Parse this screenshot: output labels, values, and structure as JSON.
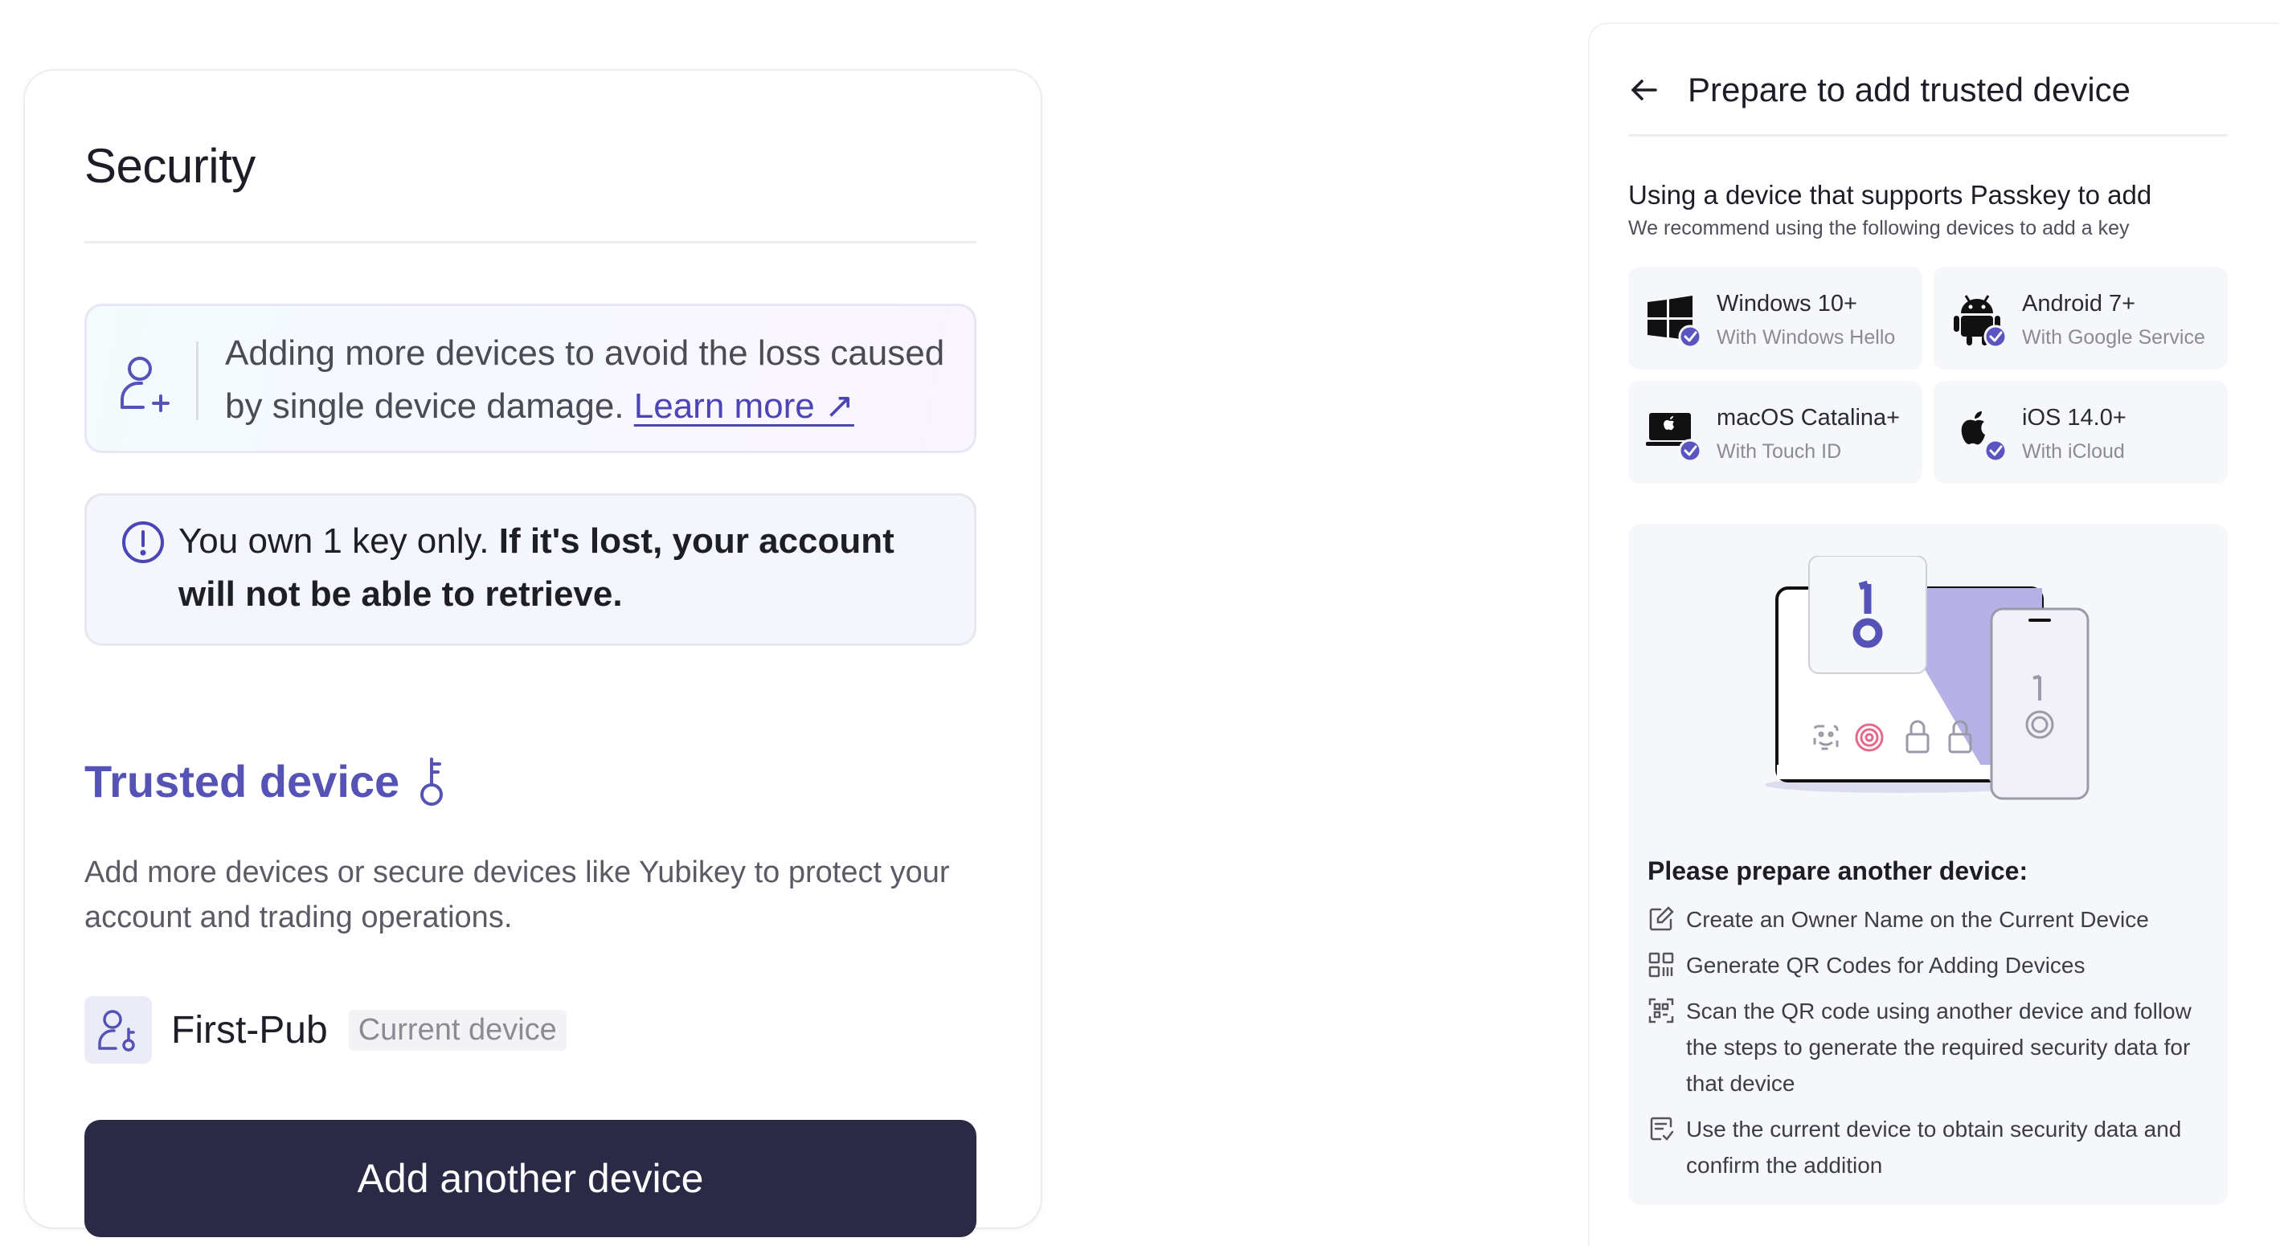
{
  "security": {
    "title": "Security",
    "info_banner": {
      "text": "Adding more devices to avoid the loss caused by single device damage.",
      "link_text": "Learn more ↗"
    },
    "warning": {
      "text_regular": "You own 1 key only.",
      "text_bold": "If it's lost, your account will not be able to retrieve."
    },
    "trusted": {
      "title": "Trusted device",
      "description": "Add more devices or secure devices like Yubikey to protect your account and trading operations."
    },
    "device": {
      "name": "First-Pub",
      "badge": "Current device"
    },
    "add_button_label": "Add another device"
  },
  "prepare_panel": {
    "title": "Prepare to add trusted device",
    "subtitle": "Using a device that supports Passkey to add",
    "subdesc": "We recommend using the following devices to add a key",
    "os_options": [
      {
        "name": "Windows 10+",
        "sub": "With Windows Hello",
        "icon": "windows-icon"
      },
      {
        "name": "Android 7+",
        "sub": "With Google Service",
        "icon": "android-icon"
      },
      {
        "name": "macOS Catalina+",
        "sub": "With Touch ID",
        "icon": "macbook-icon"
      },
      {
        "name": "iOS 14.0+",
        "sub": "With iCloud",
        "icon": "apple-icon"
      }
    ],
    "prep_title": "Please prepare another device:",
    "steps": [
      {
        "text": "Create an Owner Name on the Current Device",
        "icon": "edit-icon"
      },
      {
        "text": "Generate QR Codes for Adding Devices",
        "icon": "qr-icon"
      },
      {
        "text": "Scan the QR code using another device and follow the steps to generate the required security data for that device",
        "icon": "scan-icon"
      },
      {
        "text": "Use the current device to obtain security data and confirm the addition",
        "icon": "document-check-icon"
      }
    ]
  },
  "colors": {
    "accent": "#5553b5",
    "button_bg": "#2a2a47",
    "check_badge": "#5a55c0"
  }
}
